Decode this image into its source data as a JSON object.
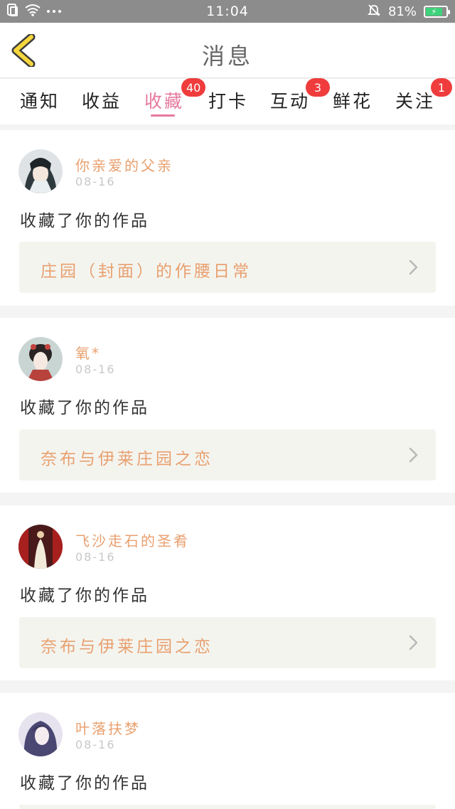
{
  "status_bar": {
    "time": "11:04",
    "battery": "81%"
  },
  "header": {
    "title": "消息"
  },
  "tabs": [
    {
      "label": "通知",
      "badge": ""
    },
    {
      "label": "收益",
      "badge": ""
    },
    {
      "label": "收藏",
      "badge": "40"
    },
    {
      "label": "打卡",
      "badge": ""
    },
    {
      "label": "互动",
      "badge": "3"
    },
    {
      "label": "鲜花",
      "badge": ""
    },
    {
      "label": "关注",
      "badge": "1"
    }
  ],
  "messages": [
    {
      "username": "你亲爱的父亲",
      "date": "08-16",
      "action": "收藏了你的作品",
      "work": "庄园（封面）的作腰日常"
    },
    {
      "username": "氧*",
      "date": "08-16",
      "action": "收藏了你的作品",
      "work": "奈布与伊莱庄园之恋"
    },
    {
      "username": "飞沙走石的圣肴",
      "date": "08-16",
      "action": "收藏了你的作品",
      "work": "奈布与伊莱庄园之恋"
    },
    {
      "username": "叶落扶梦",
      "date": "08-16",
      "action": "收藏了你的作品",
      "work": ""
    }
  ],
  "colors": {
    "accent_pink": "#e6799f",
    "username_orange": "#e8a06f",
    "badge_red": "#f03c3c",
    "back_arrow_yellow": "#f5d63d"
  }
}
